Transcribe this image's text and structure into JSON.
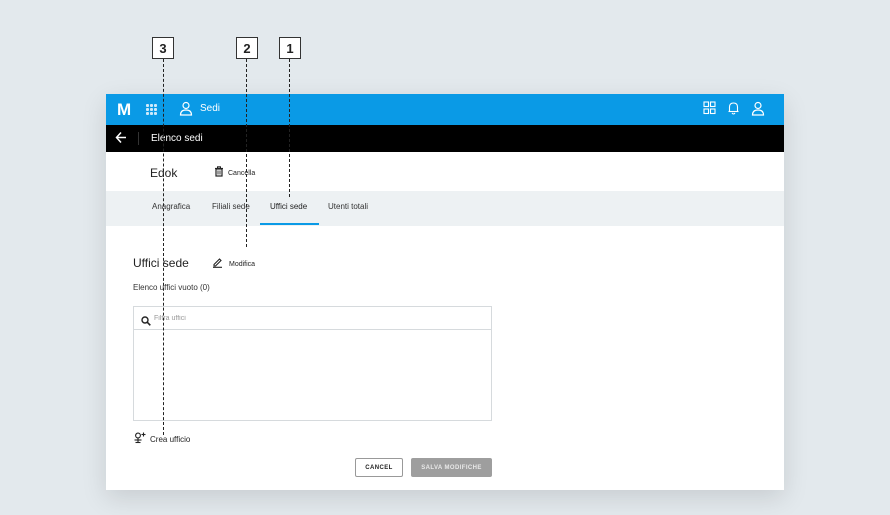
{
  "callouts": [
    "3",
    "2",
    "1"
  ],
  "topbar": {
    "logo": "M",
    "title": "Sedi",
    "icons": [
      "apps-grid-icon",
      "user-icon",
      "dashboard-icon",
      "bell-icon",
      "account-icon"
    ]
  },
  "subbar": {
    "back_icon": "arrow-left-icon",
    "title": "Elenco sedi"
  },
  "header": {
    "entity_name": "Edok",
    "delete_label": "Cancella"
  },
  "tabs": [
    {
      "label": "Anagrafica",
      "active": false
    },
    {
      "label": "Filiali sede",
      "active": false
    },
    {
      "label": "Uffici sede",
      "active": true
    },
    {
      "label": "Utenti totali",
      "active": false
    }
  ],
  "section": {
    "title": "Uffici sede",
    "edit_label": "Modifica",
    "list_caption": "Elenco uffici vuoto (0)",
    "filter_placeholder": "Filtra uffici",
    "create_label": "Crea ufficio"
  },
  "actions": {
    "cancel_label": "CANCEL",
    "save_label": "SALVA MODIFICHE"
  },
  "colors": {
    "primary": "#0a9ae6",
    "subbar": "#000000",
    "tabs_bg": "#edf1f3",
    "disabled_button": "#9e9e9e"
  }
}
